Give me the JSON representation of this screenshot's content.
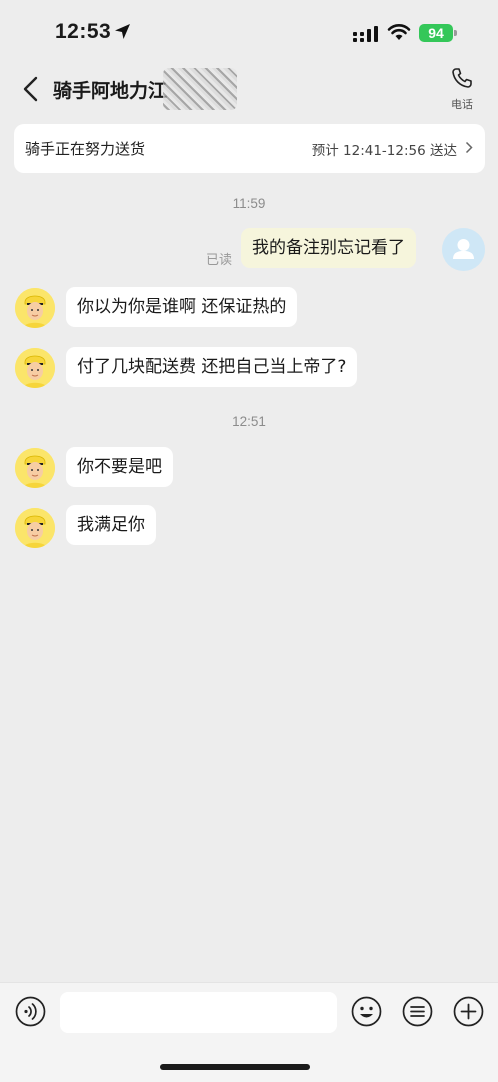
{
  "status_bar": {
    "time": "12:53",
    "battery": "94"
  },
  "header": {
    "rider_name": "骑手阿地力江",
    "call_label": "电话"
  },
  "delivery_status": {
    "text": "骑手正在努力送货",
    "eta": "预计 12:41-12:56 送达"
  },
  "chat": {
    "timestamps": [
      "11:59",
      "12:51"
    ],
    "read_label": "已读",
    "messages": [
      {
        "from": "me",
        "text": "我的备注别忘记看了"
      },
      {
        "from": "rider",
        "text": "你以为你是谁啊 还保证热的"
      },
      {
        "from": "rider",
        "text": "付了几块配送费 还把自己当上帝了?"
      },
      {
        "from": "rider",
        "text": "你不要是吧"
      },
      {
        "from": "rider",
        "text": "我满足你"
      }
    ]
  },
  "input_bar": {
    "input_value": "",
    "icons": [
      "voice-icon",
      "emoji-icon",
      "quick-reply-icon",
      "plus-icon"
    ]
  },
  "colors": {
    "background": "#ededed",
    "outgoing_bubble": "#f6f5dc",
    "incoming_bubble": "#ffffff",
    "battery": "#34c759",
    "rider_avatar": "#fbe56a"
  }
}
